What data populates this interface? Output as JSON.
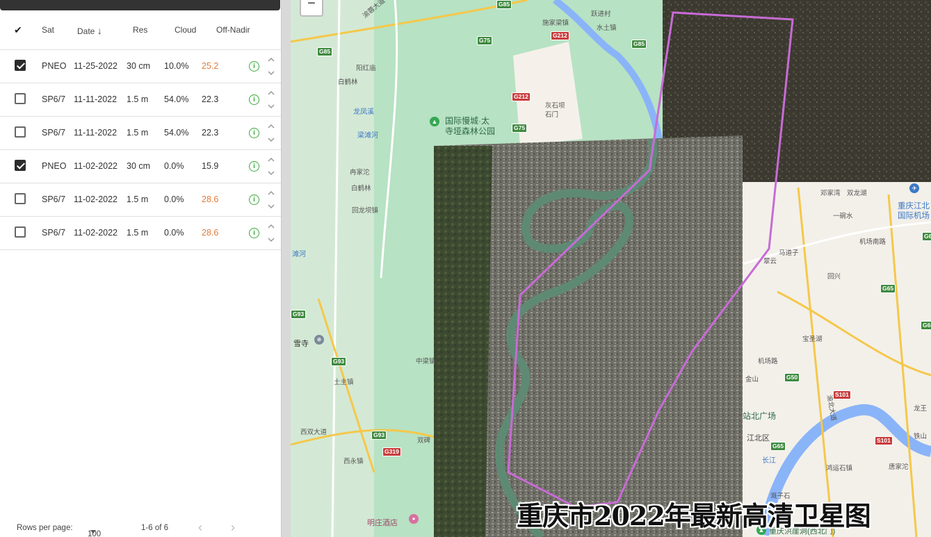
{
  "table": {
    "columns": {
      "check": "✔",
      "sat": "Sat",
      "date": "Date",
      "res": "Res",
      "cloud": "Cloud",
      "nadir": "Off-Nadir"
    },
    "sort_indicator": "↓",
    "rows": [
      {
        "checked": true,
        "sat": "PNEO",
        "date": "11-25-2022",
        "res": "30 cm",
        "cloud": "10.0%",
        "nadir": "25.2",
        "nadir_warn": true
      },
      {
        "checked": false,
        "sat": "SP6/7",
        "date": "11-11-2022",
        "res": "1.5 m",
        "cloud": "54.0%",
        "nadir": "22.3",
        "nadir_warn": false
      },
      {
        "checked": false,
        "sat": "SP6/7",
        "date": "11-11-2022",
        "res": "1.5 m",
        "cloud": "54.0%",
        "nadir": "22.3",
        "nadir_warn": false
      },
      {
        "checked": true,
        "sat": "PNEO",
        "date": "11-02-2022",
        "res": "30 cm",
        "cloud": "0.0%",
        "nadir": "15.9",
        "nadir_warn": false
      },
      {
        "checked": false,
        "sat": "SP6/7",
        "date": "11-02-2022",
        "res": "1.5 m",
        "cloud": "0.0%",
        "nadir": "28.6",
        "nadir_warn": true
      },
      {
        "checked": false,
        "sat": "SP6/7",
        "date": "11-02-2022",
        "res": "1.5 m",
        "cloud": "0.0%",
        "nadir": "28.6",
        "nadir_warn": true
      }
    ],
    "info_glyph": "i"
  },
  "footer": {
    "rows_per_page_label": "Rows per page:",
    "rows_per_page_value": "100",
    "range": "1-6 of 6",
    "prev": "‹",
    "next": "›"
  },
  "map": {
    "zoom_out": "−",
    "watermark": "重庆市2022年最新高清卫星图",
    "labels": {
      "l1": "跃进村",
      "l2": "施家梁镇",
      "l3": "水土镇",
      "l4": "阳红庙",
      "l5": "白鹤林",
      "l6": "龙凤溪",
      "l7": "梁滩河",
      "l8": "国际慢城·太",
      "l9": "寺垭森林公园",
      "l10": "灰石坝",
      "l11": "石门",
      "l12": "冉家沱",
      "l13": "白鹤林",
      "l14": "回龙坝镇",
      "l15": "滩河",
      "l16": "雪寺",
      "l17": "中梁镇",
      "l18": "土主镇",
      "l19": "西双大道",
      "l20": "西永镇",
      "l21": "双碑",
      "l22": "明庄酒店",
      "l23": "邓家湾",
      "l24": "双龙湖",
      "l25": "一碗水",
      "l26": "重庆江北",
      "l27": "国际机场",
      "l28": "机场南路",
      "l29": "马道子",
      "l30": "翠云",
      "l31": "回兴",
      "l32": "宝圣湖",
      "l33": "机场路",
      "l34": "金山",
      "l35": "站北广场",
      "l36": "江北区",
      "l37": "长江",
      "l38": "鸿运石镇",
      "l39": "唐家沱",
      "l40": "铁山",
      "l41": "溉子石",
      "l42": "重庆洪崖洞(西北门)",
      "l43": "龙王",
      "l44": "渝蓉大道",
      "l45": "渝北大道"
    },
    "shields": {
      "s1": "G85",
      "s2": "G85",
      "s3": "G75",
      "s4": "G212",
      "s5": "G85",
      "s6": "G212",
      "s7": "G75",
      "s8": "G93",
      "s9": "G93",
      "s10": "G93",
      "s11": "G319",
      "s12": "G50",
      "s13": "G65",
      "s14": "G65",
      "s15": "S101",
      "s16": "S101",
      "s17": "G65",
      "s18": "G6"
    }
  }
}
